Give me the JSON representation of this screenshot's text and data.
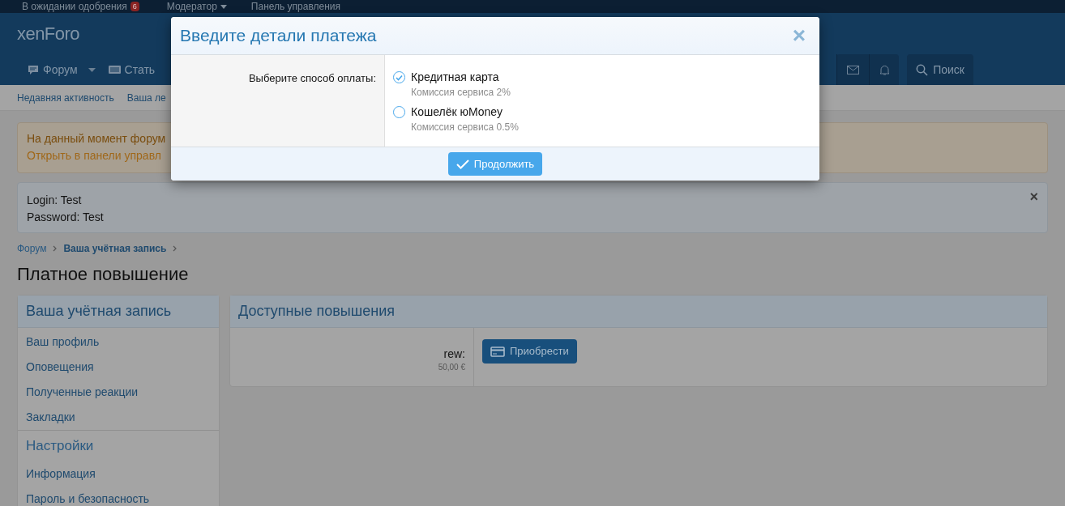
{
  "top_bar": {
    "items": [
      {
        "label": "В ожидании одобрения",
        "badge": "6",
        "caret": false
      },
      {
        "label": "Модератор",
        "caret": true
      },
      {
        "label": "Панель управления",
        "caret": false
      }
    ]
  },
  "logo": "xenForo",
  "nav": {
    "tabs": [
      {
        "label": "Форум",
        "kind": "forum",
        "caret": true
      },
      {
        "label": "Стать",
        "kind": "articles",
        "caret": false
      }
    ],
    "search": "Поиск"
  },
  "sub_nav": [
    "Недавняя активность",
    "Ваша ле"
  ],
  "notice": {
    "line1": "На данный момент форум",
    "line2": "Открыть в панели управл"
  },
  "info_notice": {
    "lines": [
      "Login: Test",
      "Password: Test"
    ],
    "close": "×"
  },
  "breadcrumbs": [
    {
      "label": "Форум",
      "current": false
    },
    {
      "label": "Ваша учётная запись",
      "current": true
    }
  ],
  "page_title": "Платное повышение",
  "sidebar": {
    "sections": [
      {
        "title": "Ваша учётная запись",
        "items": [
          "Ваш профиль",
          "Оповещения",
          "Полученные реакции",
          "Закладки"
        ]
      },
      {
        "title": "Настройки",
        "items": [
          "Информация",
          "Пароль и безопасность"
        ]
      }
    ]
  },
  "upgrades": {
    "title": "Доступные повышения",
    "rows": [
      {
        "name": "rew:",
        "price": "50,00 €",
        "button": "Приобрести"
      }
    ]
  },
  "modal": {
    "title": "Введите детали платежа",
    "close": "×",
    "field_label": "Выберите способ оплаты:",
    "options": [
      {
        "label": "Кредитная карта",
        "hint": "Комиссия сервиса 2%",
        "selected": true
      },
      {
        "label": "Кошелёк юMoney",
        "hint": "Комиссия сервиса 0.5%",
        "selected": false
      }
    ],
    "submit": "Продолжить"
  }
}
